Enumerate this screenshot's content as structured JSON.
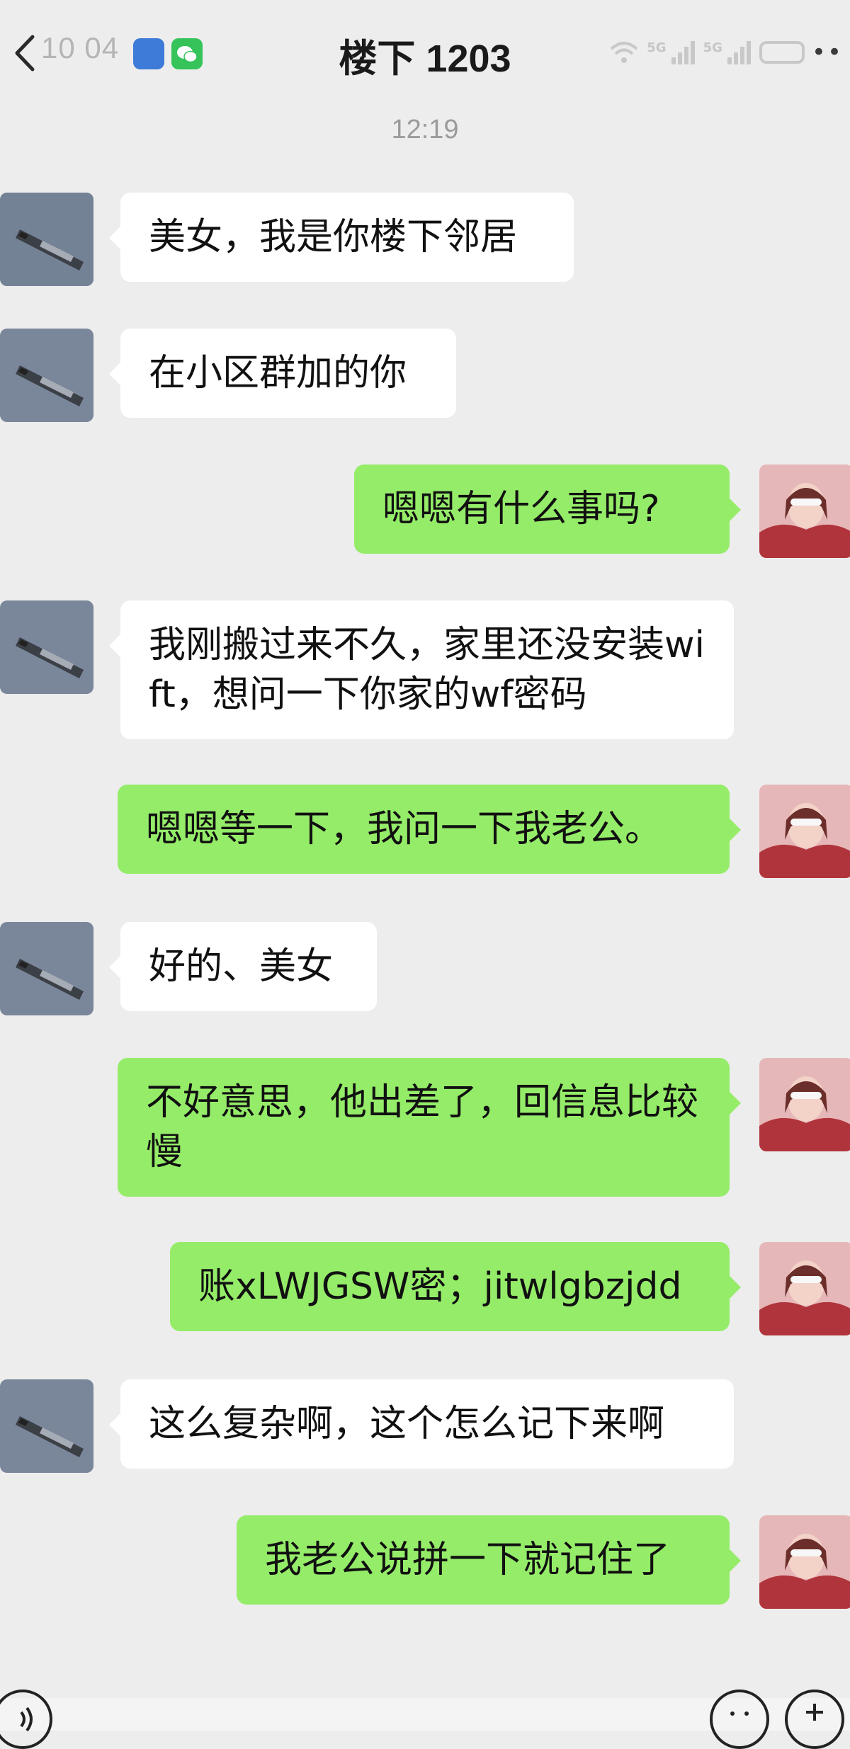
{
  "status_bar": {
    "time": "10 04",
    "signal_1": "5G",
    "signal_2": "5G",
    "more": "••"
  },
  "header": {
    "title": "楼下 1203"
  },
  "timestamp": "12:19",
  "messages": [
    {
      "side": "left",
      "text": "美女，我是你楼下邻居"
    },
    {
      "side": "left",
      "text": "在小区群加的你"
    },
    {
      "side": "right",
      "text": "嗯嗯有什么事吗?"
    },
    {
      "side": "left",
      "text": "我刚搬过来不久，家里还没安装wift，想问一下你家的wf密码"
    },
    {
      "side": "right",
      "text": "嗯嗯等一下，我问一下我老公。"
    },
    {
      "side": "left",
      "text": "好的、美女"
    },
    {
      "side": "right",
      "text": "不好意思，他出差了，回信息比较慢"
    },
    {
      "side": "right",
      "text": "账xLWJGSW密；jitwlgbzjdd"
    },
    {
      "side": "left",
      "text": "这么复杂啊，这个怎么记下来啊"
    },
    {
      "side": "right",
      "text": "我老公说拼一下就记住了"
    }
  ],
  "colors": {
    "background": "#ededed",
    "bubble_self": "#95ec69",
    "bubble_other": "#ffffff"
  }
}
